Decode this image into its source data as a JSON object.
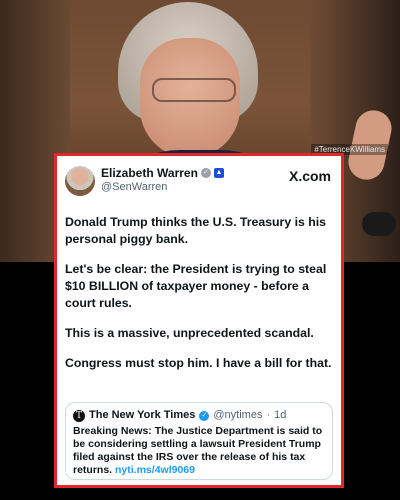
{
  "photo": {
    "watermark": "#TerrenceKWilliams"
  },
  "tweet": {
    "display_name": "Elizabeth Warren",
    "handle": "@SenWarren",
    "platform": "X.com",
    "paragraphs": [
      "Donald Trump thinks the U.S. Treasury is his personal piggy bank.",
      "Let's be clear: the President is trying to steal $10 BILLION of taxpayer money - before a court rules.",
      "This is a massive, unprecedented scandal.",
      "Congress must stop him. I have a bill for that."
    ],
    "quoted": {
      "logo_letter": "T",
      "name": "The New York Times",
      "handle": "@nytimes",
      "dot": "·",
      "age": "1d",
      "text": "Breaking News: The Justice Department is said to be considering settling a lawsuit President Trump filed against the IRS over the release of his tax returns.",
      "link": "nyti.ms/4wl9069"
    }
  },
  "colors": {
    "card_border": "#e0272b",
    "link": "#1d9bf0"
  }
}
